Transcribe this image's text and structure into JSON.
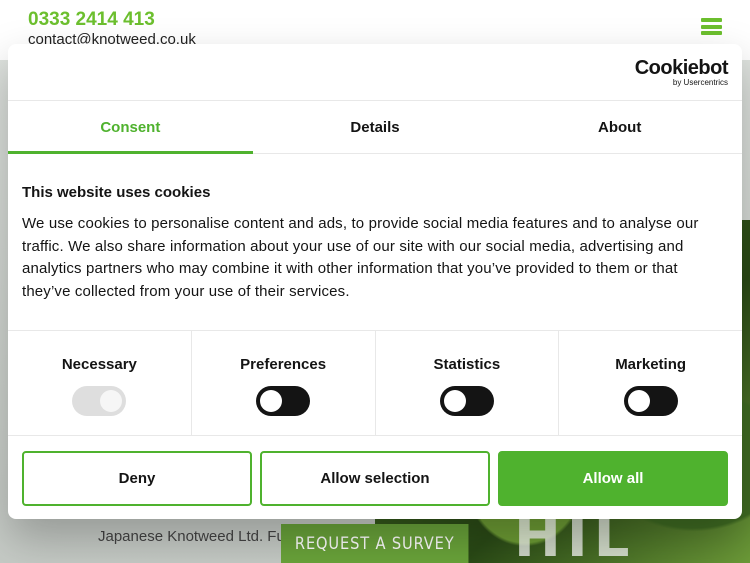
{
  "site": {
    "phone": "0333 2414 413",
    "email": "contact@knotweed.co.uk",
    "hero_text": "Japanese Knotweed Ltd. Fu accredited and qualified to",
    "survey_button": "REQUEST A SURVEY",
    "hero_letters": "HIL"
  },
  "dialog": {
    "logo_main": "Cookiebot",
    "logo_sub": "by Usercentrics",
    "tabs": [
      {
        "label": "Consent"
      },
      {
        "label": "Details"
      },
      {
        "label": "About"
      }
    ],
    "heading": "This website uses cookies",
    "body": "We use cookies to personalise content and ads, to provide social media features and to analyse our traffic. We also share information about your use of our site with our social media, advertising and analytics partners who may combine it with other information that you’ve provided to them or that they’ve collected from your use of their services.",
    "categories": [
      {
        "label": "Necessary",
        "enabled": true,
        "locked": true
      },
      {
        "label": "Preferences",
        "enabled": false
      },
      {
        "label": "Statistics",
        "enabled": false
      },
      {
        "label": "Marketing",
        "enabled": false
      }
    ],
    "buttons": {
      "deny": "Deny",
      "allow_selection": "Allow selection",
      "allow_all": "Allow all"
    }
  },
  "colors": {
    "accent": "#4fb22e",
    "brand_green": "#6cbf2e",
    "toggle_off": "#141414"
  }
}
